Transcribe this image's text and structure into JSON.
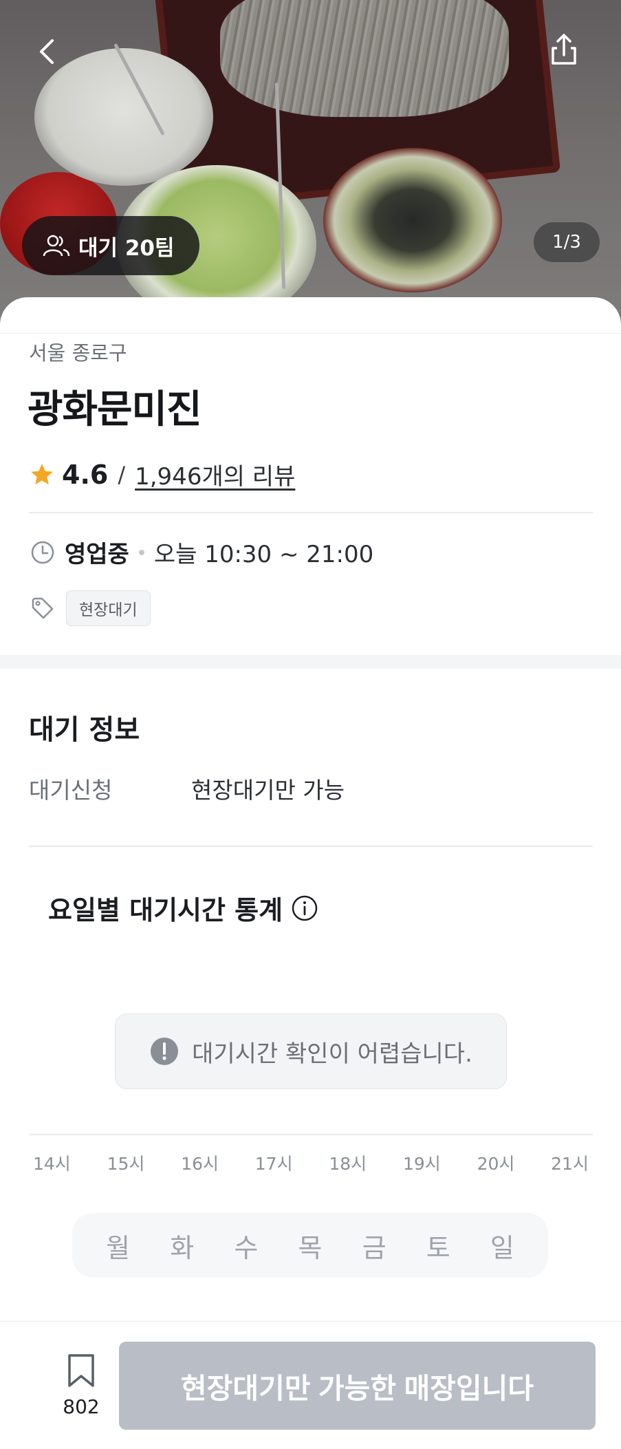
{
  "hero": {
    "wait_badge": "대기 20팀",
    "page_indicator": "1/3"
  },
  "store": {
    "region": "서울 종로구",
    "name": "광화문미진",
    "rating": "4.6",
    "separator": "/",
    "reviews": "1,946개의 리뷰",
    "status": "영업중",
    "hours": "오늘 10:30 ~ 21:00",
    "tag": "현장대기"
  },
  "wait_info": {
    "title": "대기 정보",
    "key": "대기신청",
    "value": "현장대기만 가능"
  },
  "stats": {
    "title": "요일별 대기시간 통계",
    "notice": "대기시간 확인이 어렵습니다.",
    "hours": [
      "14시",
      "15시",
      "16시",
      "17시",
      "18시",
      "19시",
      "20시",
      "21시"
    ],
    "days": [
      "월",
      "화",
      "수",
      "목",
      "금",
      "토",
      "일"
    ]
  },
  "bottom": {
    "bookmark_count": "802",
    "cta": "현장대기만 가능한 매장입니다"
  },
  "colors": {
    "accent_star": "#f5a623",
    "cta_disabled": "#b9bec6"
  },
  "icons": [
    "back-icon",
    "share-icon",
    "people-icon",
    "star-icon",
    "clock-icon",
    "tag-icon",
    "info-icon",
    "alert-icon",
    "bookmark-icon"
  ]
}
